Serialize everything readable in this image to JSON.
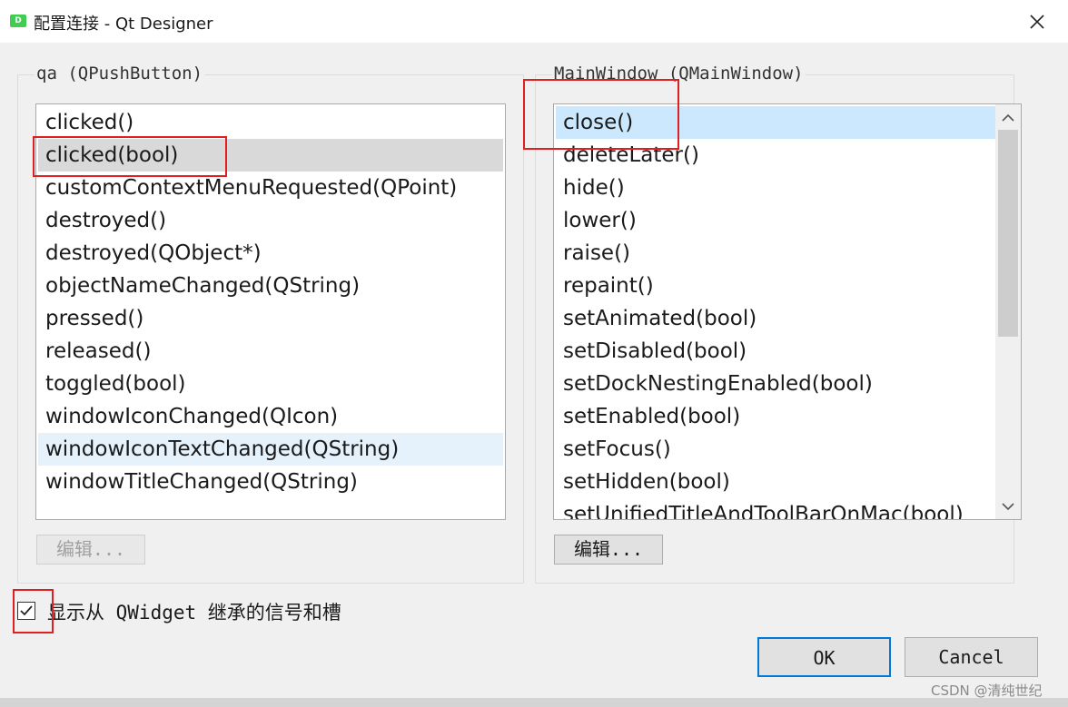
{
  "window": {
    "title": "配置连接 - Qt Designer",
    "icon_text": "D",
    "close_icon": "close-icon"
  },
  "left_group": {
    "title": "qa (QPushButton)",
    "signals": [
      "clicked()",
      "clicked(bool)",
      "customContextMenuRequested(QPoint)",
      "destroyed()",
      "destroyed(QObject*)",
      "objectNameChanged(QString)",
      "pressed()",
      "released()",
      "toggled(bool)",
      "windowIconChanged(QIcon)",
      "windowIconTextChanged(QString)",
      "windowTitleChanged(QString)"
    ],
    "selected": "clicked(bool)",
    "hovered": "windowIconTextChanged(QString)",
    "edit_button": "编辑..."
  },
  "right_group": {
    "title": "MainWindow (QMainWindow)",
    "slots": [
      "close()",
      "deleteLater()",
      "hide()",
      "lower()",
      "raise()",
      "repaint()",
      "setAnimated(bool)",
      "setDisabled(bool)",
      "setDockNestingEnabled(bool)",
      "setEnabled(bool)",
      "setFocus()",
      "setHidden(bool)",
      "setUnifiedTitleAndToolBarOnMac(bool)"
    ],
    "selected": "close()",
    "edit_button": "编辑..."
  },
  "checkbox": {
    "label": "显示从 QWidget 继承的信号和槽",
    "checked": true
  },
  "buttons": {
    "ok": "OK",
    "cancel": "Cancel"
  },
  "watermark": "CSDN @清纯世纪",
  "colors": {
    "selection_blue": "#cce8ff",
    "selection_gray": "#d9d9d9",
    "annotation_red": "#e02020",
    "focus_border": "#0078d7"
  }
}
